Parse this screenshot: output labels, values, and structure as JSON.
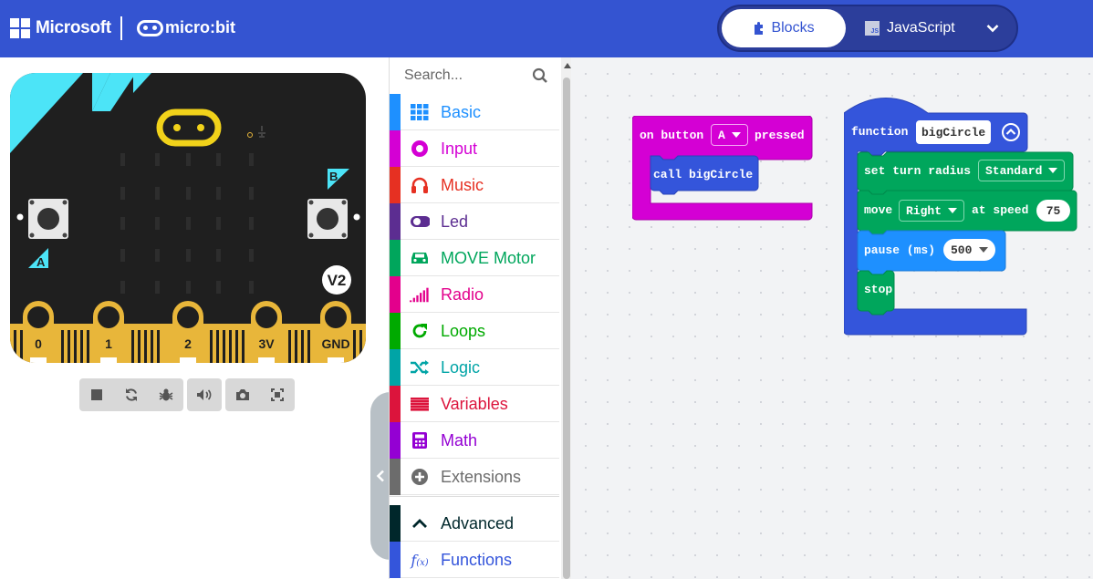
{
  "header": {
    "brand": "Microsoft",
    "product": "micro:bit",
    "modes": {
      "blocks": "Blocks",
      "javascript": "JavaScript",
      "js_badge": "JS"
    },
    "colors": {
      "bar": "#3454d1"
    }
  },
  "simulator": {
    "board": {
      "button_a": "A",
      "button_b": "B",
      "version": "V2",
      "pins": [
        "0",
        "1",
        "2",
        "3V",
        "GND"
      ]
    },
    "toolbar": {
      "buttons": [
        "stop-icon",
        "restart-icon",
        "debug-icon",
        "sound-icon",
        "screenshot-icon",
        "fullscreen-icon"
      ]
    }
  },
  "toolbox": {
    "search_placeholder": "Search...",
    "categories": [
      {
        "label": "Basic",
        "color": "#1e90ff",
        "icon": "grid-icon"
      },
      {
        "label": "Input",
        "color": "#d400d4",
        "icon": "circle-dot-icon"
      },
      {
        "label": "Music",
        "color": "#e63022",
        "icon": "headphones-icon"
      },
      {
        "label": "Led",
        "color": "#5c2d91",
        "icon": "toggle-icon"
      },
      {
        "label": "MOVE Motor",
        "color": "#00a65c",
        "icon": "car-icon"
      },
      {
        "label": "Radio",
        "color": "#e3008c",
        "icon": "signal-bars-icon"
      },
      {
        "label": "Loops",
        "color": "#00aa00",
        "icon": "refresh-icon"
      },
      {
        "label": "Logic",
        "color": "#00a4a6",
        "icon": "shuffle-icon"
      },
      {
        "label": "Variables",
        "color": "#dc143c",
        "icon": "list-icon"
      },
      {
        "label": "Math",
        "color": "#9400d3",
        "icon": "calculator-icon"
      },
      {
        "label": "Extensions",
        "color": "#6c6c6c",
        "icon": "plus-circle-icon"
      }
    ],
    "advanced": {
      "label": "Advanced",
      "color": "#00272b",
      "icon": "chevron-up-icon"
    },
    "functions": {
      "label": "Functions",
      "color": "#3455db",
      "icon": "fx-icon"
    }
  },
  "workspace": {
    "event_block": {
      "prefix": "on button",
      "button": "A",
      "suffix": "pressed",
      "inner_call": "call bigCircle",
      "color": "#d400d4"
    },
    "function_block": {
      "keyword": "function",
      "name": "bigCircle",
      "color": "#3455db",
      "statements": [
        {
          "text": "set turn radius",
          "dropdown": "Standard",
          "color": "#00a65c"
        },
        {
          "text": "move",
          "dropdown": "Right",
          "mid": "at speed",
          "value": "75",
          "color": "#00a65c"
        },
        {
          "text": "pause (ms)",
          "value": "500",
          "color": "#1e90ff"
        },
        {
          "text": "stop",
          "color": "#00a65c"
        }
      ]
    }
  }
}
